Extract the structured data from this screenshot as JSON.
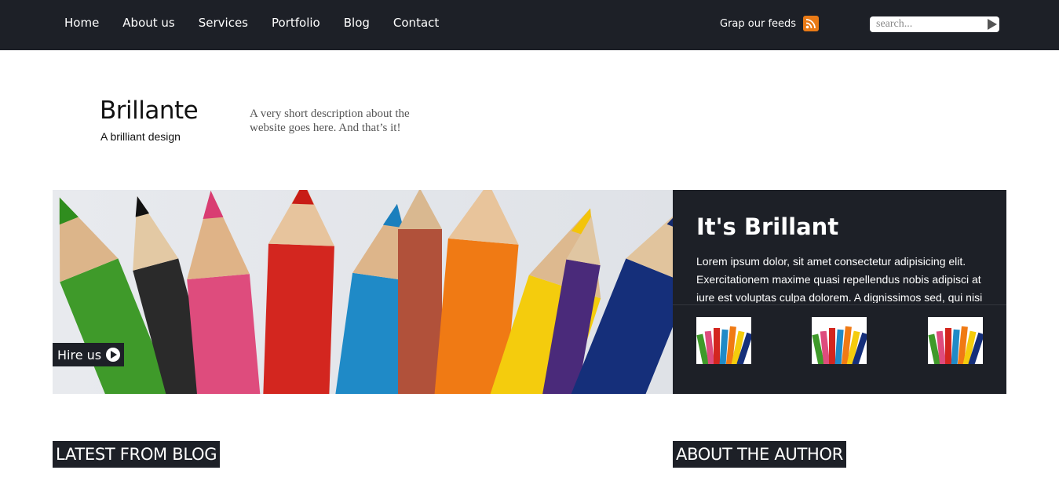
{
  "nav": {
    "items": [
      "Home",
      "About us",
      "Services",
      "Portfolio",
      "Blog",
      "Contact"
    ],
    "feeds_label": "Grap our feeds",
    "search_placeholder": "search..."
  },
  "brand": {
    "title": "Brillante",
    "tagline": "A brilliant design",
    "description": "A very short description about the website goes here. And that’s it!"
  },
  "hero": {
    "hire_label": "Hire us",
    "panel_title": "It's Brillant",
    "panel_text": "Lorem ipsum dolor, sit amet consectetur adipisicing elit. Exercitationem maxime quasi repellendus nobis adipisci at iure est voluptas culpa dolorem. A dignissimos sed, qui nisi"
  },
  "sections": {
    "latest_blog": "LATEST FROM BLOG",
    "about_author": "ABOUT THE AUTHOR"
  },
  "colors": {
    "dark": "#1d2027",
    "rss": "#e97a16"
  },
  "icons": [
    "rss-icon",
    "search-submit-icon",
    "play-circle-icon"
  ]
}
